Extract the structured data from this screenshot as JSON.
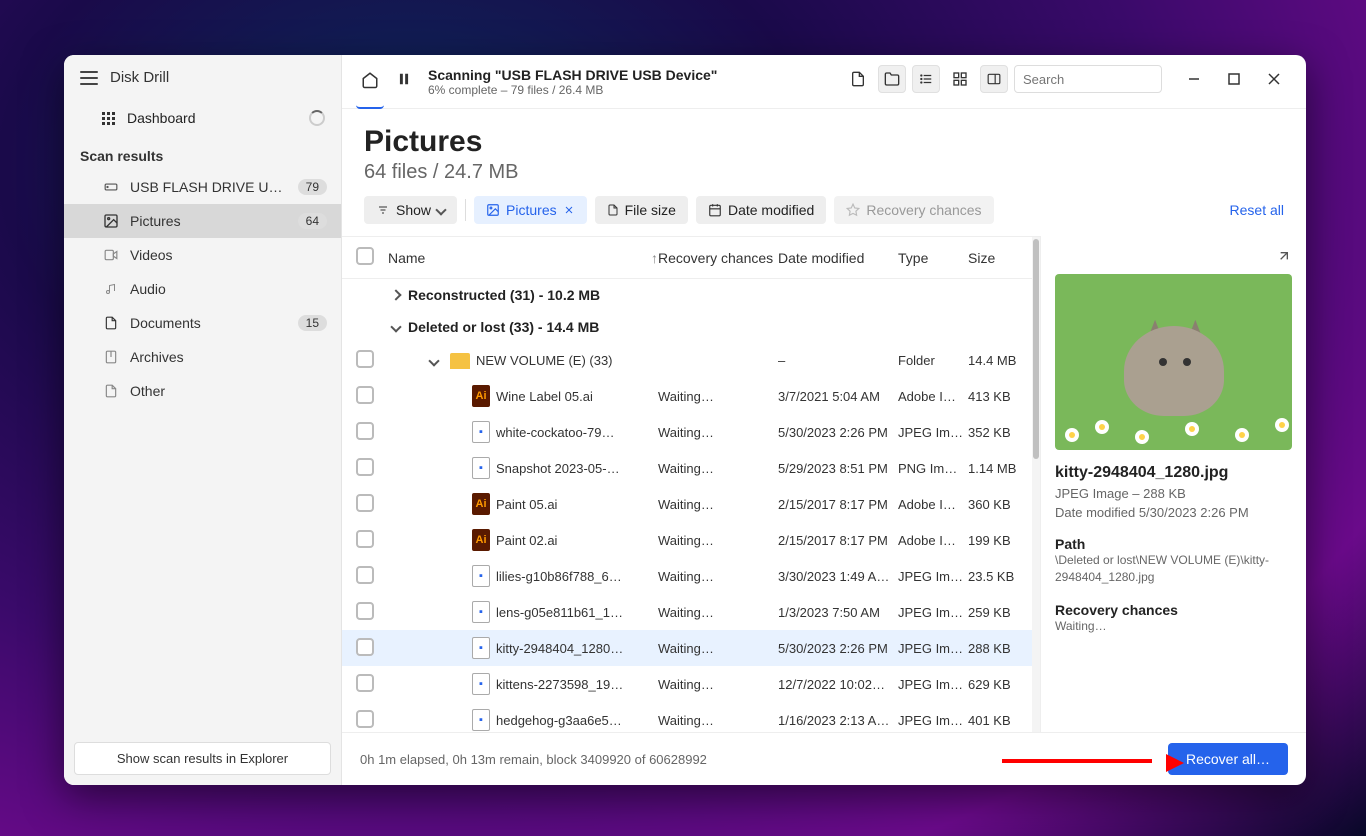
{
  "app_title": "Disk Drill",
  "dashboard_label": "Dashboard",
  "scan_results_label": "Scan results",
  "sidebar": {
    "items": [
      {
        "label": "USB FLASH DRIVE USB D…",
        "badge": "79",
        "icon": "drive"
      },
      {
        "label": "Pictures",
        "badge": "64",
        "icon": "pictures",
        "selected": true
      },
      {
        "label": "Videos",
        "badge": "",
        "icon": "videos"
      },
      {
        "label": "Audio",
        "badge": "",
        "icon": "audio"
      },
      {
        "label": "Documents",
        "badge": "15",
        "icon": "documents"
      },
      {
        "label": "Archives",
        "badge": "",
        "icon": "archives"
      },
      {
        "label": "Other",
        "badge": "",
        "icon": "other"
      }
    ],
    "explorer_btn": "Show scan results in Explorer"
  },
  "topbar": {
    "scan_title": "Scanning \"USB FLASH DRIVE USB Device\"",
    "scan_sub": "6% complete – 79 files / 26.4 MB",
    "search_placeholder": "Search"
  },
  "hero": {
    "title": "Pictures",
    "subtitle": "64 files / 24.7 MB"
  },
  "filters": {
    "show": "Show",
    "pictures": "Pictures",
    "file_size": "File size",
    "date_modified": "Date modified",
    "recovery_chances": "Recovery chances",
    "reset": "Reset all"
  },
  "columns": {
    "name": "Name",
    "rec": "Recovery chances",
    "date": "Date modified",
    "type": "Type",
    "size": "Size"
  },
  "groups": [
    {
      "label": "Reconstructed (31) - 10.2 MB",
      "expanded": false
    },
    {
      "label": "Deleted or lost (33) - 14.4 MB",
      "expanded": true
    }
  ],
  "folder_row": {
    "name": "NEW VOLUME (E) (33)",
    "date": "–",
    "type": "Folder",
    "size": "14.4 MB"
  },
  "rows": [
    {
      "name": "Wine Label 05.ai",
      "rec": "Waiting…",
      "date": "3/7/2021 5:04 AM",
      "type": "Adobe I…",
      "size": "413 KB",
      "icon": "ai"
    },
    {
      "name": "white-cockatoo-79…",
      "rec": "Waiting…",
      "date": "5/30/2023 2:26 PM",
      "type": "JPEG Im…",
      "size": "352 KB",
      "icon": "img"
    },
    {
      "name": "Snapshot 2023-05-…",
      "rec": "Waiting…",
      "date": "5/29/2023 8:51 PM",
      "type": "PNG Im…",
      "size": "1.14 MB",
      "icon": "img"
    },
    {
      "name": "Paint 05.ai",
      "rec": "Waiting…",
      "date": "2/15/2017 8:17 PM",
      "type": "Adobe I…",
      "size": "360 KB",
      "icon": "ai"
    },
    {
      "name": "Paint 02.ai",
      "rec": "Waiting…",
      "date": "2/15/2017 8:17 PM",
      "type": "Adobe I…",
      "size": "199 KB",
      "icon": "ai"
    },
    {
      "name": "lilies-g10b86f788_6…",
      "rec": "Waiting…",
      "date": "3/30/2023 1:49 A…",
      "type": "JPEG Im…",
      "size": "23.5 KB",
      "icon": "img"
    },
    {
      "name": "lens-g05e811b61_1…",
      "rec": "Waiting…",
      "date": "1/3/2023 7:50 AM",
      "type": "JPEG Im…",
      "size": "259 KB",
      "icon": "img"
    },
    {
      "name": "kitty-2948404_1280…",
      "rec": "Waiting…",
      "date": "5/30/2023 2:26 PM",
      "type": "JPEG Im…",
      "size": "288 KB",
      "icon": "img",
      "selected": true
    },
    {
      "name": "kittens-2273598_19…",
      "rec": "Waiting…",
      "date": "12/7/2022 10:02…",
      "type": "JPEG Im…",
      "size": "629 KB",
      "icon": "img"
    },
    {
      "name": "hedgehog-g3aa6e5…",
      "rec": "Waiting…",
      "date": "1/16/2023 2:13 A…",
      "type": "JPEG Im…",
      "size": "401 KB",
      "icon": "img"
    }
  ],
  "preview": {
    "name": "kitty-2948404_1280.jpg",
    "meta": "JPEG Image – 288 KB",
    "date_line": "Date modified 5/30/2023 2:26 PM",
    "path_label": "Path",
    "path_value": "\\Deleted or lost\\NEW VOLUME (E)\\kitty-2948404_1280.jpg",
    "rec_label": "Recovery chances",
    "rec_value": "Waiting…"
  },
  "bottom": {
    "status": "0h 1m elapsed, 0h 13m remain, block 3409920 of 60628992",
    "recover": "Recover all…"
  }
}
